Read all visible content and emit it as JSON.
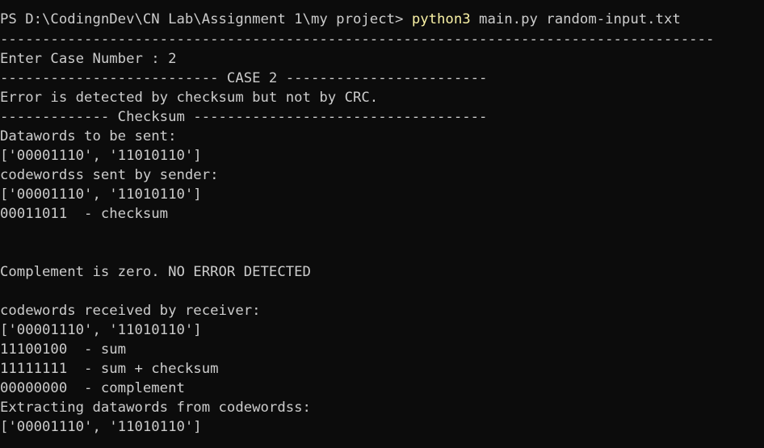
{
  "terminal": {
    "prompt": "PS D:\\CodingnDev\\CN Lab\\Assignment 1\\my project> ",
    "command": "python3",
    "args": " main.py random-input.txt",
    "colors": {
      "background": "#0c0c0c",
      "text": "#cccccc",
      "command_highlight": "#f9f1a5"
    },
    "lines": [
      "-------------------------------------------------------------------------------------",
      "Enter Case Number : 2",
      "-------------------------- CASE 2 ------------------------",
      "Error is detected by checksum but not by CRC.",
      "------------- Checksum -----------------------------------",
      "Datawords to be sent:",
      "['00001110', '11010110']",
      "codewordss sent by sender:",
      "['00001110', '11010110']",
      "00011011  - checksum",
      "",
      "",
      "Complement is zero. NO ERROR DETECTED",
      "",
      "codewords received by receiver:",
      "['00001110', '11010110']",
      "11100100  - sum",
      "11111111  - sum + checksum",
      "00000000  - complement",
      "Extracting datawords from codewordss:",
      "['00001110', '11010110']"
    ]
  }
}
